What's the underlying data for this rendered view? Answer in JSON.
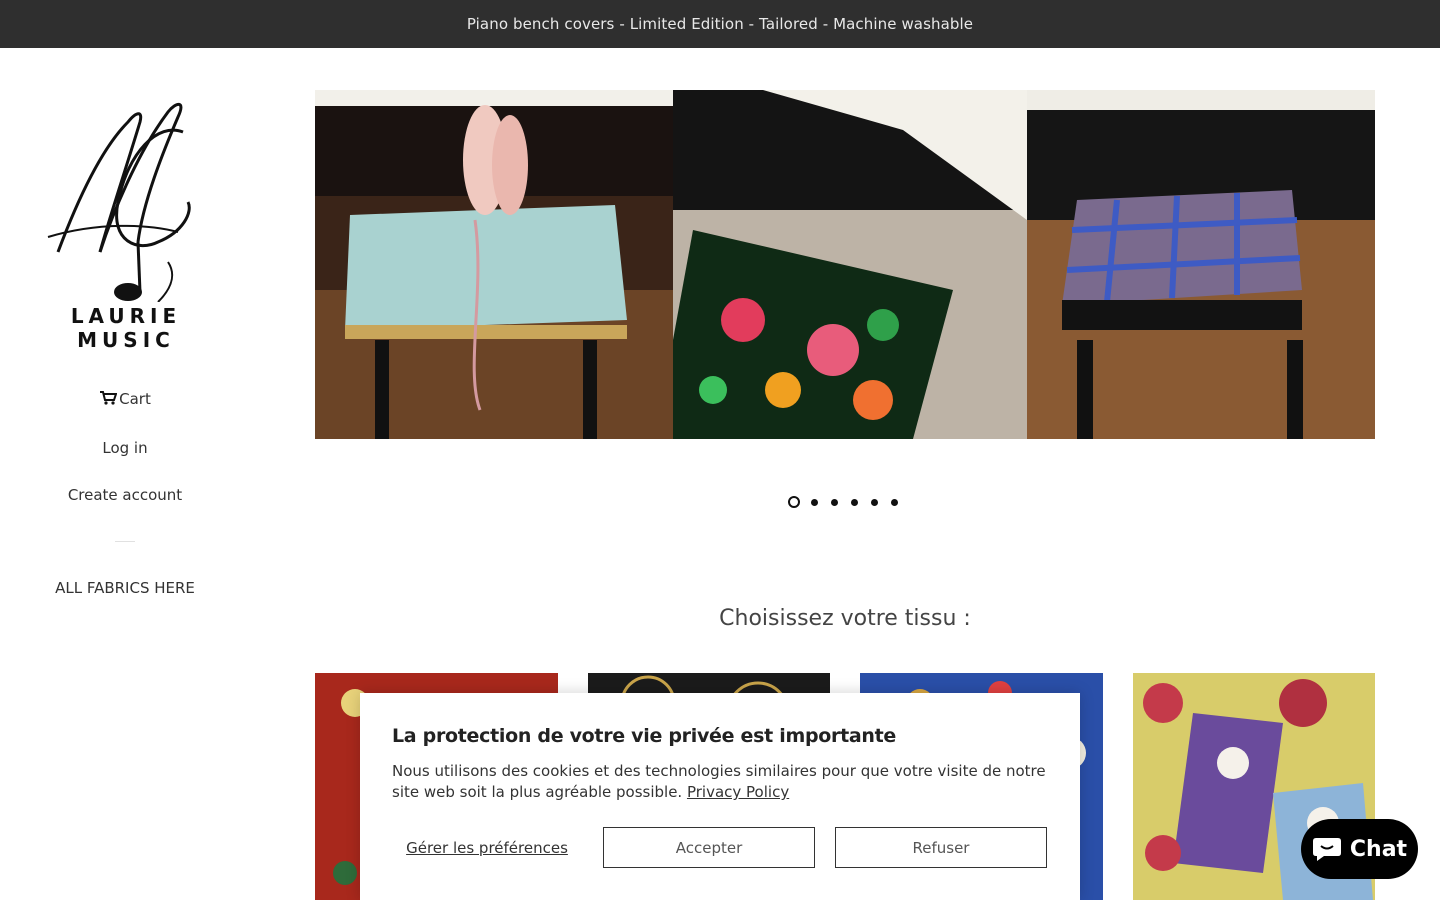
{
  "announcement": "Piano bench covers - Limited Edition - Tailored - Machine washable",
  "logo": {
    "text": "LAURIE MUSIC"
  },
  "nav": {
    "cart": "Cart",
    "login": "Log in",
    "create_account": "Create account",
    "fabrics": "ALL FABRICS HERE"
  },
  "slider": {
    "dot_count": 6,
    "active_dot": 1
  },
  "section_title": "Choisissez votre tissu :",
  "cookie": {
    "title": "La protection de votre vie privée est importante",
    "body": "Nous utilisons des cookies et des technologies similaires pour que votre visite de notre site web soit la plus agréable possible. ",
    "privacy_link": "Privacy Policy",
    "prefs": "Gérer les préférences",
    "accept": "Accepter",
    "refuse": "Refuser"
  },
  "chat": {
    "label": "Chat"
  },
  "colors": {
    "announce_bg": "#2f2f2f",
    "chat_bg": "#000000"
  }
}
